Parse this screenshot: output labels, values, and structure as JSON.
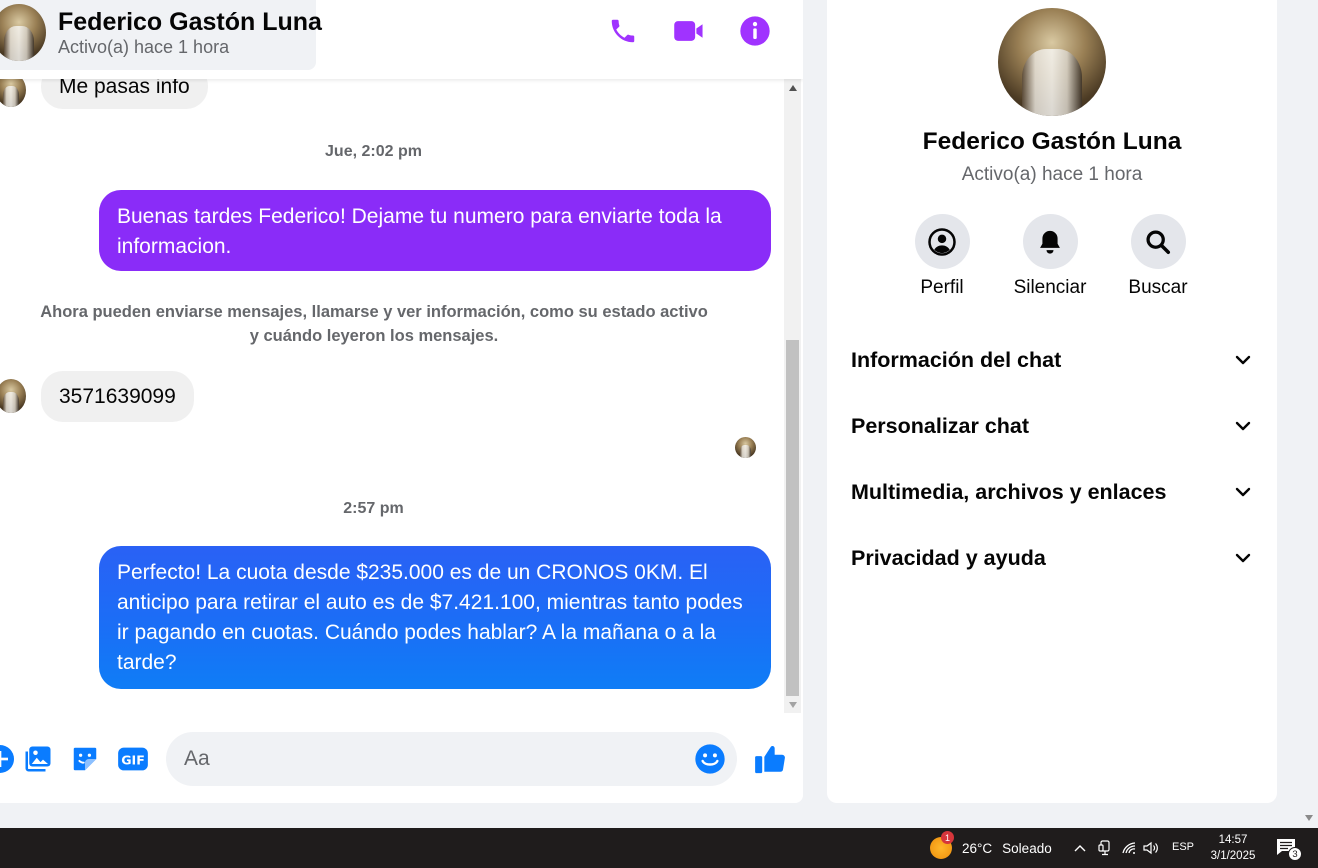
{
  "chat": {
    "contact_name": "Federico Gastón Luna",
    "contact_status": "Activo(a) hace 1 hora",
    "messages": [
      {
        "text": "Me pasas info",
        "direction": "incoming"
      },
      {
        "text": "Buenas tardes Federico! Dejame tu numero para enviarte toda la informacion.",
        "direction": "outgoing"
      },
      {
        "text": "3571639099",
        "direction": "incoming"
      },
      {
        "text": "Perfecto! La cuota desde $235.000 es de un CRONOS 0KM. El anticipo para retirar el auto es de $7.421.100, mientras tanto podes ir pagando en cuotas. Cuándo podes hablar? A la mañana o a la tarde?",
        "direction": "outgoing"
      }
    ],
    "timestamps": [
      "Jue, 2:02 pm",
      "2:57 pm"
    ],
    "system_notice": "Ahora pueden enviarse mensajes, llamarse y ver información, como su estado activo y cuándo leyeron los mensajes.",
    "input_placeholder": "Aa"
  },
  "info_panel": {
    "name": "Federico Gastón Luna",
    "status": "Activo(a) hace 1 hora",
    "actions": [
      {
        "label": "Perfil",
        "icon": "profile-icon"
      },
      {
        "label": "Silenciar",
        "icon": "bell-icon"
      },
      {
        "label": "Buscar",
        "icon": "search-icon"
      }
    ],
    "sections": [
      {
        "title": "Información del chat"
      },
      {
        "title": "Personalizar chat"
      },
      {
        "title": "Multimedia, archivos y enlaces"
      },
      {
        "title": "Privacidad y ayuda"
      }
    ]
  },
  "taskbar": {
    "weather_temp": "26°C",
    "weather_condition": "Soleado",
    "weather_badge": "1",
    "language": "ESP",
    "time": "14:57",
    "date": "3/1/2025",
    "notification_count": "3"
  },
  "colors": {
    "accent_purple": "#a033ff",
    "bubble_purple": "#8a2cf8",
    "bubble_blue": "#1b6ef6",
    "messenger_blue": "#0a7cff"
  }
}
